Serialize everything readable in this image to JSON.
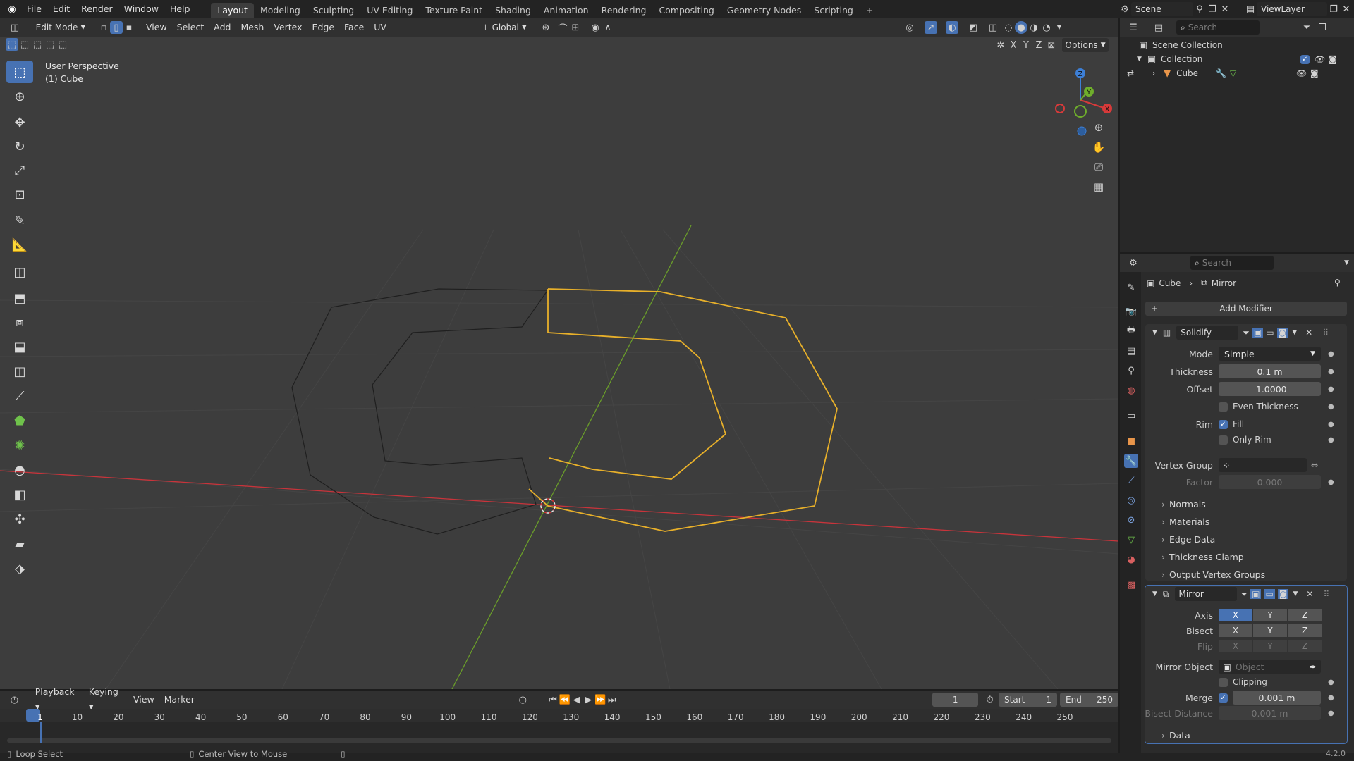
{
  "topbar": {
    "menus": [
      "File",
      "Edit",
      "Render",
      "Window",
      "Help"
    ],
    "workspaces": [
      "Layout",
      "Modeling",
      "Sculpting",
      "UV Editing",
      "Texture Paint",
      "Shading",
      "Animation",
      "Rendering",
      "Compositing",
      "Geometry Nodes",
      "Scripting"
    ],
    "active_workspace": "Layout",
    "add_tab": "+",
    "scene": "Scene",
    "view_layer": "ViewLayer"
  },
  "viewport_header": {
    "mode": "Edit Mode",
    "menus": [
      "View",
      "Select",
      "Add",
      "Mesh",
      "Vertex",
      "Edge",
      "Face",
      "UV"
    ],
    "orientation": "Global",
    "options": "Options",
    "axes": [
      "X",
      "Y",
      "Z"
    ]
  },
  "viewport": {
    "view_name": "User Perspective",
    "object_name": "(1) Cube",
    "gizmo": {
      "x": "X",
      "y": "Y",
      "z": "Z"
    }
  },
  "outliner": {
    "search_placeholder": "Search",
    "scene_collection": "Scene Collection",
    "collection": "Collection",
    "object": "Cube"
  },
  "properties": {
    "search_placeholder": "Search",
    "breadcrumb_object": "Cube",
    "breadcrumb_modifier": "Mirror",
    "add_modifier": "Add Modifier",
    "solidify": {
      "name": "Solidify",
      "mode_label": "Mode",
      "mode_value": "Simple",
      "thickness_label": "Thickness",
      "thickness_value": "0.1 m",
      "offset_label": "Offset",
      "offset_value": "-1.0000",
      "even_thickness": "Even Thickness",
      "rim_label": "Rim",
      "fill": "Fill",
      "only_rim": "Only Rim",
      "vertex_group_label": "Vertex Group",
      "factor_label": "Factor",
      "factor_value": "0.000",
      "subpanels": [
        "Normals",
        "Materials",
        "Edge Data",
        "Thickness Clamp",
        "Output Vertex Groups"
      ]
    },
    "mirror": {
      "name": "Mirror",
      "axis_label": "Axis",
      "bisect_label": "Bisect",
      "flip_label": "Flip",
      "axes": [
        "X",
        "Y",
        "Z"
      ],
      "mirror_object_label": "Mirror Object",
      "mirror_object_placeholder": "Object",
      "clipping": "Clipping",
      "merge_label": "Merge",
      "merge_value": "0.001 m",
      "bisect_distance_label": "Bisect Distance",
      "bisect_distance_value": "0.001 m",
      "data_subpanel": "Data"
    }
  },
  "timeline": {
    "menus": [
      "Playback",
      "Keying",
      "View",
      "Marker"
    ],
    "current_frame": "1",
    "start_label": "Start",
    "start_value": "1",
    "end_label": "End",
    "end_value": "250",
    "ticks": [
      "1",
      "10",
      "20",
      "30",
      "40",
      "50",
      "60",
      "70",
      "80",
      "90",
      "100",
      "110",
      "120",
      "130",
      "140",
      "150",
      "160",
      "170",
      "180",
      "190",
      "200",
      "210",
      "220",
      "230",
      "240",
      "250"
    ]
  },
  "statusbar": {
    "hint1": "Loop Select",
    "hint2": "Center View to Mouse",
    "version": "4.2.0"
  },
  "colors": {
    "accent": "#4772b3",
    "selected_edges": "#e8b02a",
    "x_axis": "#c8343b",
    "y_axis": "#6a9d2a"
  }
}
